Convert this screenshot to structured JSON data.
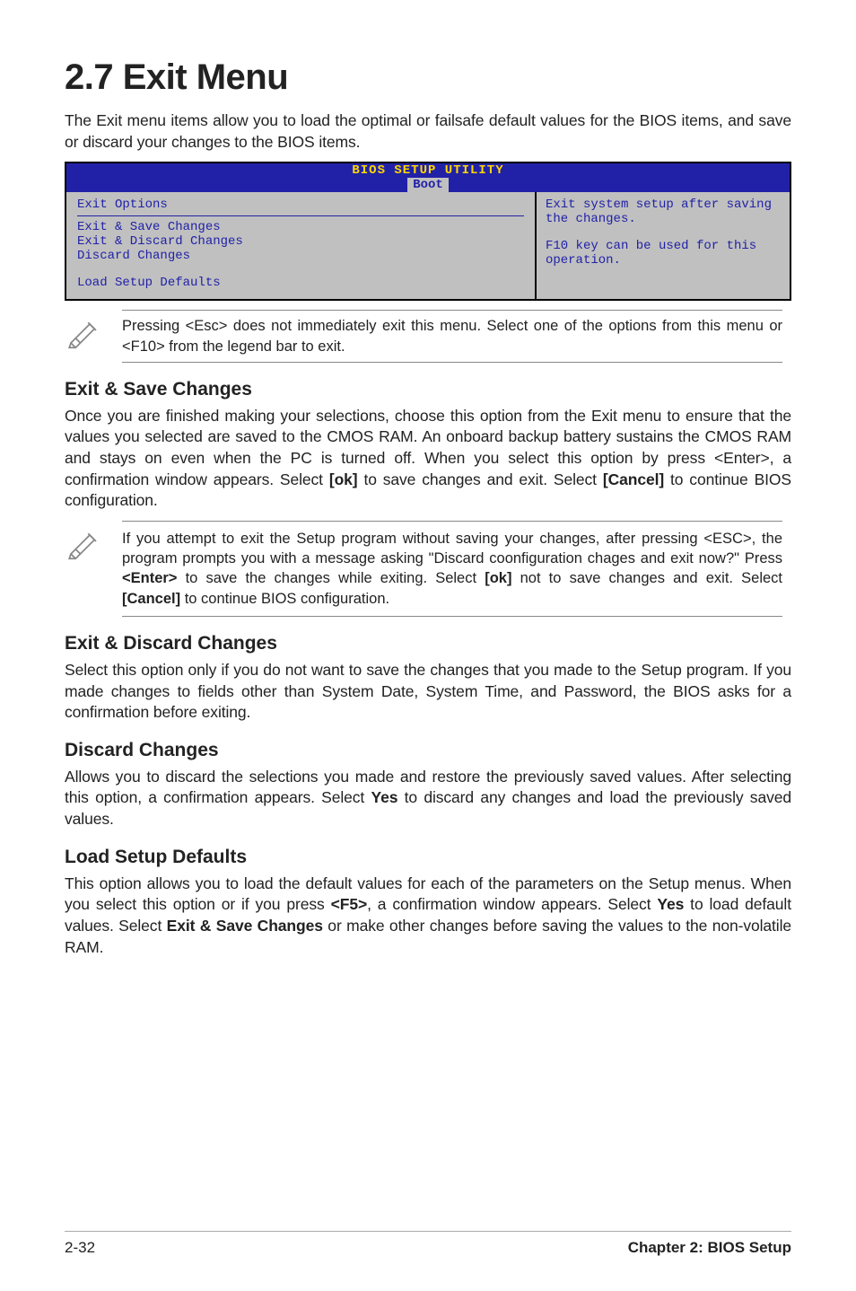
{
  "title": "2.7 Exit Menu",
  "intro": "The Exit menu items allow you to load the optimal or failsafe default values for the BIOS items, and save or discard your changes to the BIOS items.",
  "bios": {
    "header_top": "BIOS SETUP UTILITY",
    "header_tab": "Boot",
    "left": {
      "heading": "Exit Options",
      "items": [
        "Exit & Save Changes",
        "Exit & Discard Changes",
        "Discard Changes",
        "Load Setup Defaults"
      ]
    },
    "right": {
      "help1": "Exit system setup after saving the changes.",
      "help2": "F10 key can be used for this operation."
    }
  },
  "note1": "Pressing <Esc> does not immediately exit this menu. Select one of the options from this menu or <F10> from the legend bar to exit.",
  "sections": {
    "exit_save": {
      "title": "Exit & Save Changes",
      "body_before": "Once you are finished making your selections, choose this option from the Exit menu to ensure that the values you selected are saved to the CMOS RAM. An onboard backup battery sustains the CMOS RAM and stays on even when the PC is turned off. When you select this option by press <Enter>, a confirmation window appears. Select ",
      "ok": "[ok]",
      "body_mid": " to save changes and exit. Select ",
      "cancel": "[Cancel]",
      "body_after": " to continue BIOS configuration."
    },
    "note2_pre": "If you attempt to exit the Setup program without saving your changes, after pressing <ESC>, the program prompts you with a message asking \"Discard coonfiguration chages and exit now?\" Press ",
    "note2_enter": "<Enter>",
    "note2_mid": "  to save the  changes while exiting. Select ",
    "note2_ok": "[ok]",
    "note2_mid2": " not to save changes and exit. Select ",
    "note2_cancel": "[Cancel]",
    "note2_after": " to continue BIOS configuration.",
    "exit_discard": {
      "title": "Exit & Discard Changes",
      "body": "Select this option only if you do not want to save the changes that you  made to the Setup program. If you made changes to fields other than System Date, System Time, and Password, the BIOS asks for a confirmation before exiting."
    },
    "discard": {
      "title": "Discard Changes",
      "body_pre": "Allows you to discard the selections you made and restore the previously saved values. After selecting this option, a confirmation appears. Select ",
      "yes": "Yes",
      "body_after": " to discard any changes and load the previously saved values."
    },
    "load": {
      "title": "Load Setup Defaults",
      "body_pre": "This option allows you to load the default values for each of the parameters on the Setup menus. When you select this option or if you press ",
      "f5": "<F5>",
      "body_mid": ", a confirmation window appears. Select ",
      "yes": "Yes",
      "body_mid2": " to load default values. Select ",
      "exit_save": "Exit & Save Changes",
      "body_after": " or make other changes before saving the values to the non-volatile RAM."
    }
  },
  "footer": {
    "left": "2-32",
    "right": "Chapter 2: BIOS Setup"
  }
}
